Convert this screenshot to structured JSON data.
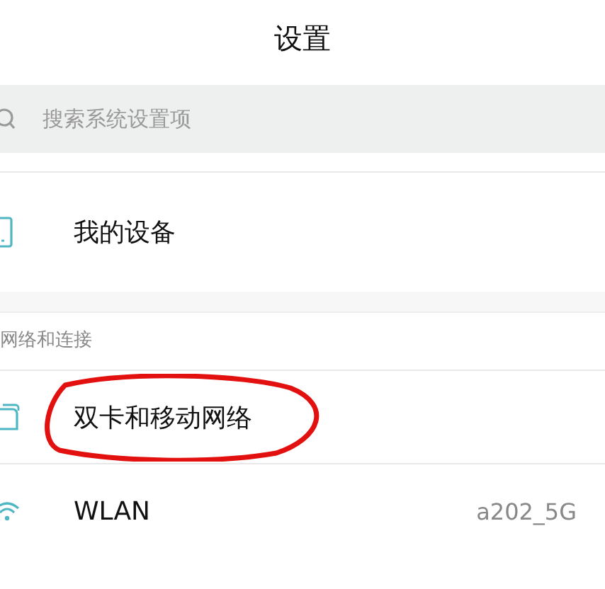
{
  "title": "设置",
  "search": {
    "placeholder": "搜索系统设置项"
  },
  "sections": [
    {
      "items": [
        {
          "kind": "device",
          "label": "我的设备",
          "circled": false
        }
      ]
    },
    {
      "header": "网络和连接",
      "items": [
        {
          "kind": "sim",
          "label": "双卡和移动网络",
          "circled": true
        },
        {
          "kind": "wifi",
          "label": "WLAN",
          "value": "a202_5G",
          "circled": false
        }
      ]
    }
  ]
}
